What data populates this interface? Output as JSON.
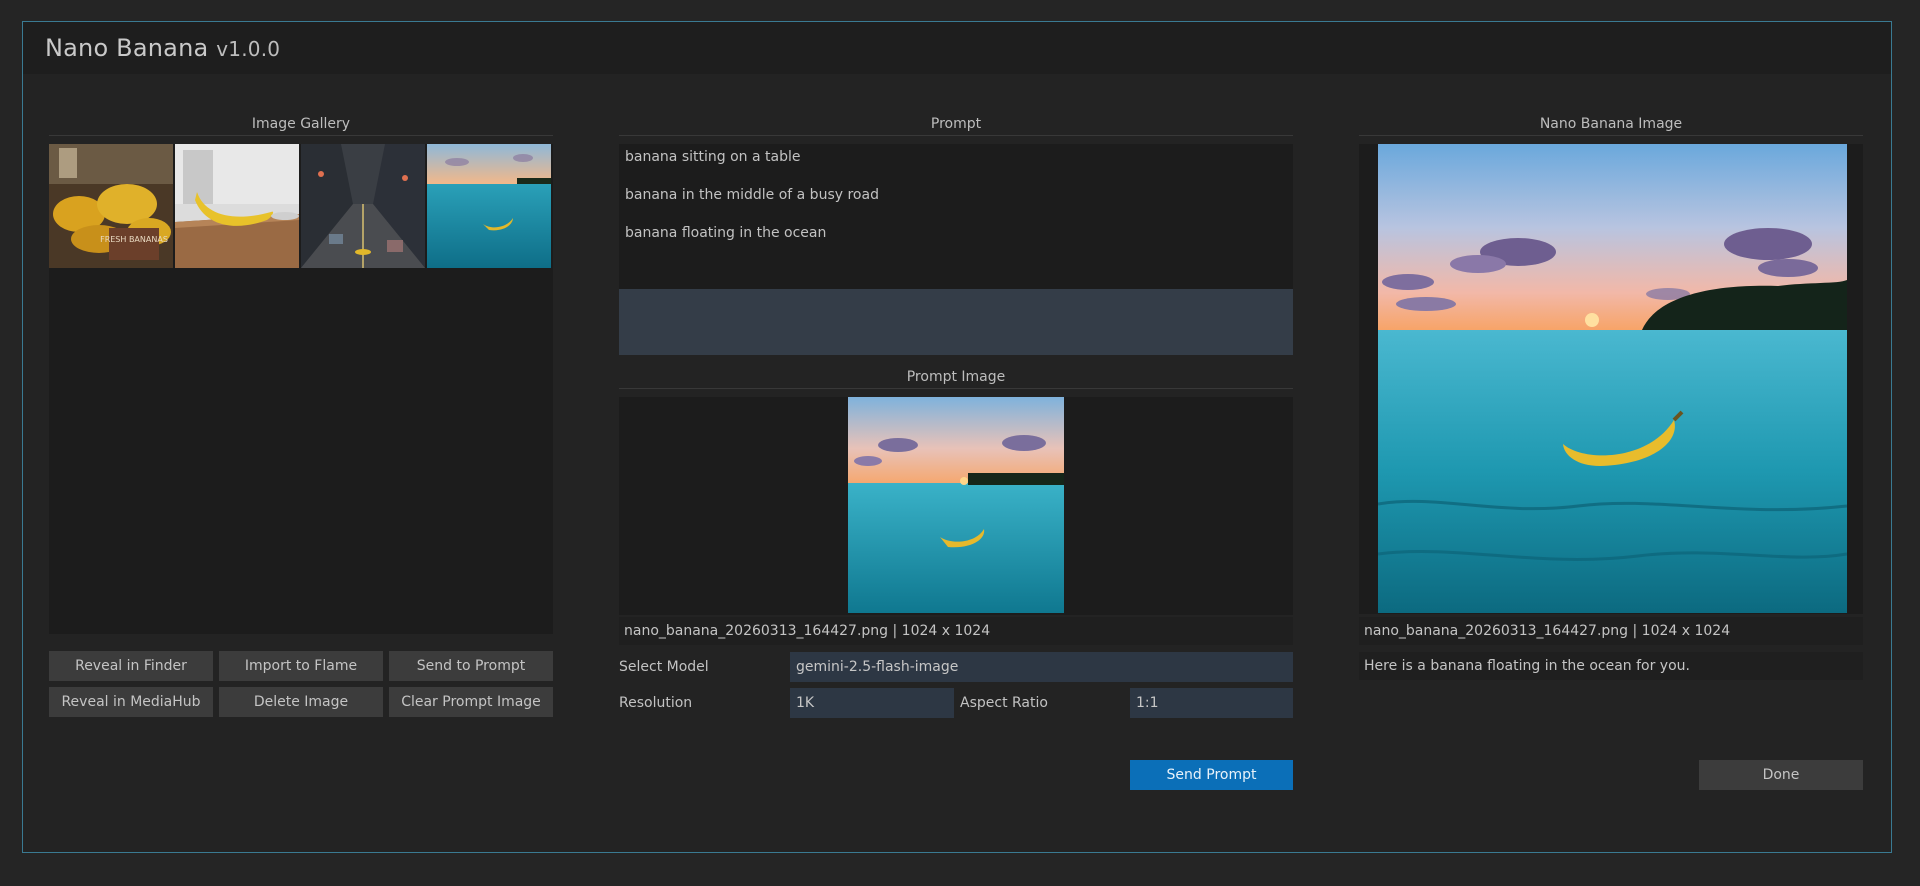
{
  "app": {
    "title": "Nano Banana",
    "version": "v1.0.0"
  },
  "gallery": {
    "title": "Image Gallery",
    "thumbnails": [
      {
        "name": "thumb-fresh-bananas",
        "caption": "FRESH BANANAS"
      },
      {
        "name": "thumb-banana-on-table"
      },
      {
        "name": "thumb-banana-busy-road"
      },
      {
        "name": "thumb-banana-ocean"
      }
    ],
    "buttons": {
      "reveal_finder": "Reveal in Finder",
      "import_flame": "Import to Flame",
      "send_to_prompt": "Send to Prompt",
      "reveal_mediahub": "Reveal in MediaHub",
      "delete_image": "Delete Image",
      "clear_prompt_image": "Clear Prompt Image"
    }
  },
  "prompt": {
    "title": "Prompt",
    "history": [
      "banana sitting on a table",
      "banana in the middle of a busy road",
      "banana floating in the ocean"
    ],
    "input_value": "",
    "image_title": "Prompt Image",
    "image_info": "nano_banana_20260313_164427.png  |  1024 x 1024",
    "model_label": "Select Model",
    "model_value": "gemini-2.5-flash-image",
    "resolution_label": "Resolution",
    "resolution_value": "1K",
    "aspect_label": "Aspect Ratio",
    "aspect_value": "1:1",
    "send_label": "Send Prompt"
  },
  "result": {
    "title": "Nano Banana Image",
    "image_info": "nano_banana_20260313_164427.png  |  1024 x 1024",
    "message": "Here is a banana floating in the ocean for you.",
    "done_label": "Done"
  },
  "colors": {
    "accent": "#0b6fb8",
    "window_border": "#3a7a92",
    "field_bg": "#2d3744"
  }
}
